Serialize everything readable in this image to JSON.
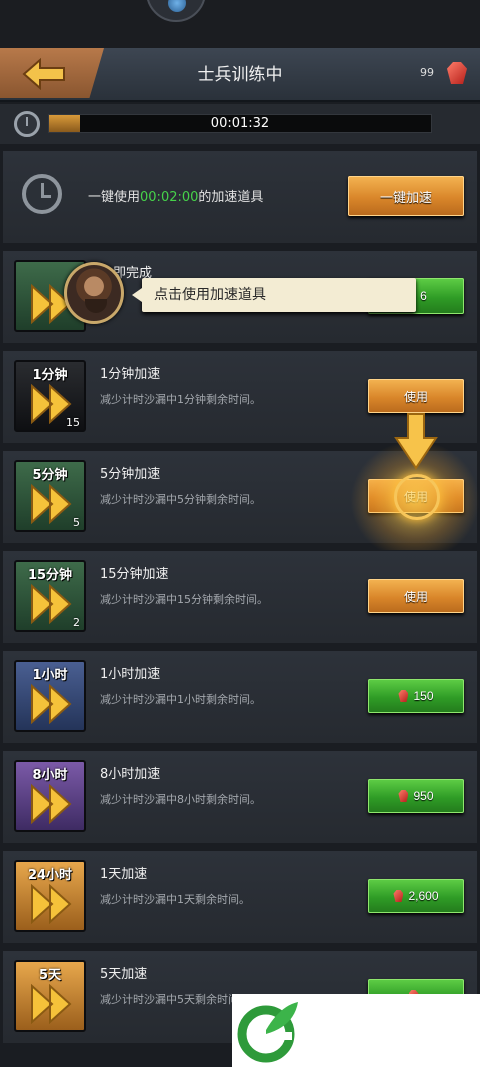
{
  "header": {
    "title": "士兵训练中",
    "gem_count": "99"
  },
  "timer": {
    "time_left": "00:01:32",
    "progress": 0.08
  },
  "one_click": {
    "prefix": "一键使用",
    "time": "00:02:00",
    "suffix": "的加速道具",
    "button": "一键加速"
  },
  "instant": {
    "title": "立即完成",
    "cost": "6"
  },
  "tooltip": {
    "text": "点击使用加速道具"
  },
  "items": [
    {
      "badge": "1分钟",
      "count": "15",
      "title": "1分钟加速",
      "desc": "减少计时沙漏中1分钟剩余时间。",
      "button": "使用",
      "style": "black"
    },
    {
      "badge": "5分钟",
      "count": "5",
      "title": "5分钟加速",
      "desc": "减少计时沙漏中5分钟剩余时间。",
      "button": "使用",
      "style": "green"
    },
    {
      "badge": "15分钟",
      "count": "2",
      "title": "15分钟加速",
      "desc": "减少计时沙漏中15分钟剩余时间。",
      "button": "使用",
      "style": "green"
    },
    {
      "badge": "1小时",
      "count": "",
      "title": "1小时加速",
      "desc": "减少计时沙漏中1小时剩余时间。",
      "button": "150",
      "style": "blue"
    },
    {
      "badge": "8小时",
      "count": "",
      "title": "8小时加速",
      "desc": "减少计时沙漏中8小时剩余时间。",
      "button": "950",
      "style": "purple"
    },
    {
      "badge": "24小时",
      "count": "",
      "title": "1天加速",
      "desc": "减少计时沙漏中1天剩余时间。",
      "button": "2,600",
      "style": "gold"
    },
    {
      "badge": "5天",
      "count": "",
      "title": "5天加速",
      "desc": "减少计时沙漏中5天剩余时间。",
      "button": "",
      "style": "gold"
    }
  ],
  "colors": {
    "accent_green": "#46d24a",
    "button_orange": "#d9862a",
    "button_green": "#2f9c26",
    "gem_red": "#b51f1a"
  }
}
